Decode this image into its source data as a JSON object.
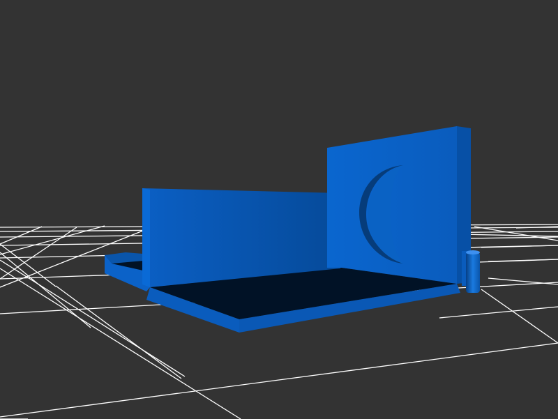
{
  "viewport": {
    "background_color": "#333333",
    "grid_color": "#ffffff",
    "show_grid": true
  },
  "model": {
    "color": "#0a64c8",
    "shadow_color": "#011226",
    "parts": [
      "base-plate",
      "back-wall",
      "side-panel",
      "circular-cutout",
      "hinge-cylinder"
    ]
  }
}
